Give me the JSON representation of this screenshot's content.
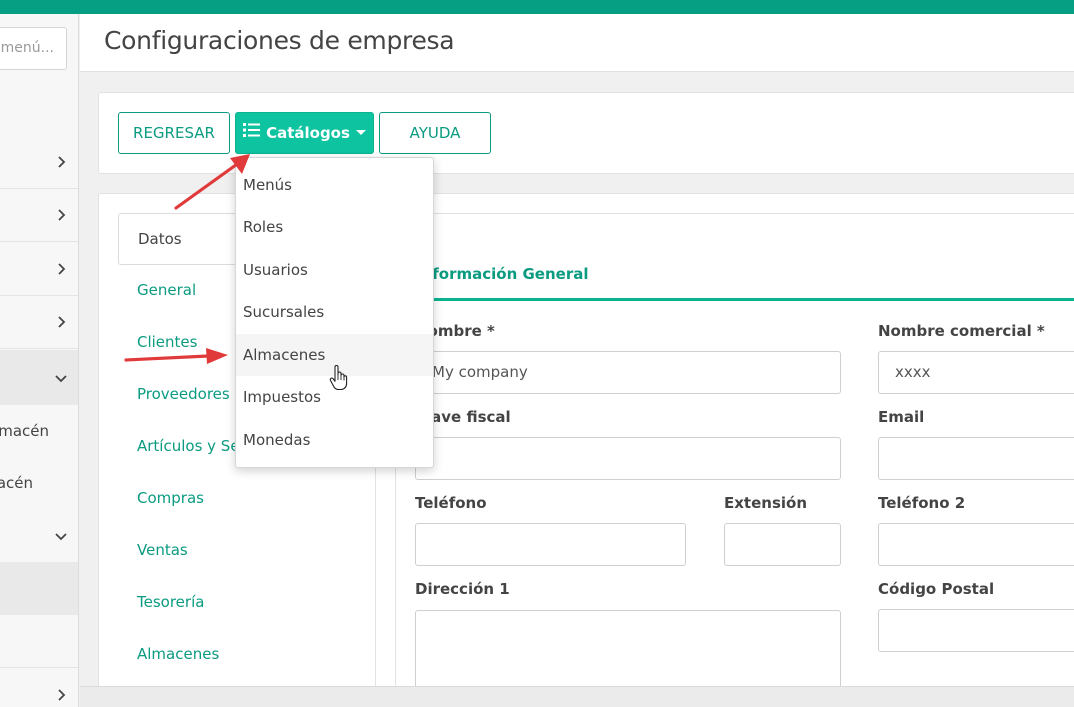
{
  "colors": {
    "accent": "#0a9b80",
    "accent_bright": "#0ec39f",
    "topbar": "#079f84",
    "arrow": "#e03a3a"
  },
  "sidebar": {
    "search_placeholder": "menú...",
    "rows": [
      {
        "icon": "chevron-right-icon"
      },
      {
        "icon": "chevron-right-icon"
      },
      {
        "icon": "chevron-right-icon"
      },
      {
        "icon": "chevron-right-icon"
      },
      {
        "icon": "chevron-down-icon"
      }
    ],
    "sub_items": [
      "macén",
      "acén"
    ],
    "extra_icons": [
      "chevron-down-icon",
      "chevron-right-icon"
    ]
  },
  "header": {
    "title": "Configuraciones de empresa"
  },
  "toolbar": {
    "back_label": "REGRESAR",
    "catalogs_label": "Catálogos",
    "catalogs_icon": "list-icon",
    "help_label": "AYUDA"
  },
  "dropdown": {
    "items": [
      "Menús",
      "Roles",
      "Usuarios",
      "Sucursales",
      "Almacenes",
      "Impuestos",
      "Monedas"
    ],
    "hovered": "Almacenes"
  },
  "tabs": {
    "active": "Datos",
    "links": [
      "General",
      "Clientes",
      "Proveedores",
      "Artículos y Se",
      "Compras",
      "Ventas",
      "Tesorería",
      "Almacenes"
    ]
  },
  "form": {
    "section_title": "Información General",
    "fields": {
      "nombre": {
        "label": "Nombre *",
        "value": "My company"
      },
      "nombre_comercial": {
        "label": "Nombre comercial *",
        "value": "xxxx"
      },
      "clave_fiscal": {
        "label": "Clave fiscal",
        "value": ""
      },
      "email": {
        "label": "Email",
        "value": ""
      },
      "telefono": {
        "label": "Teléfono",
        "value": ""
      },
      "extension": {
        "label": "Extensión",
        "value": ""
      },
      "telefono2": {
        "label": "Teléfono 2",
        "value": ""
      },
      "direccion1": {
        "label": "Dirección 1",
        "value": ""
      },
      "codigo_postal": {
        "label": "Código Postal",
        "value": ""
      }
    }
  }
}
